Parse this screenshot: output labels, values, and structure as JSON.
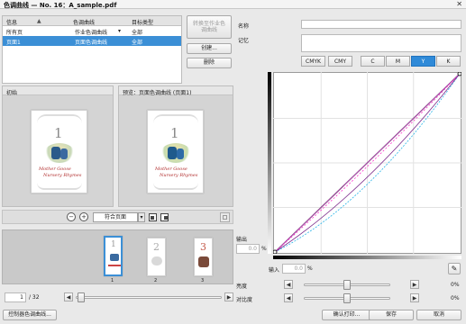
{
  "window": {
    "title": "色调曲线 — No. 16：A_sample.pdf",
    "close_glyph": "✕"
  },
  "table": {
    "columns": [
      "信息",
      "色调曲线",
      "目标类型"
    ],
    "sort_glyph": "▲",
    "rows": [
      {
        "info": "所有页",
        "curve": "作业色调曲线",
        "curve_glyph": "▾",
        "target": "全部",
        "selected": false
      },
      {
        "info": "页面1",
        "curve": "页面色调曲线",
        "curve_glyph": "",
        "target": "全部",
        "selected": true
      }
    ]
  },
  "buttons": {
    "convert": "转换至作业色\n调曲线",
    "create": "创建...",
    "delete": "删除",
    "control_tone": "控制器色调曲线...",
    "confirm_print": "确认打印...",
    "save": "保存",
    "cancel": "取消"
  },
  "panes": {
    "initial_label": "初始",
    "preview_label": "预览：页面色调曲线 (页面1)",
    "doc_number": "1",
    "doc_title_line1": "Mother Goose",
    "doc_title_line2": "Nursery Rhymes"
  },
  "zoom": {
    "zoom_out_glyph": "−",
    "zoom_in_glyph": "+",
    "fit_value": "符合页面",
    "fit_glyph": "▾"
  },
  "thumbnails": [
    {
      "label": "1",
      "number": "1",
      "color": "#cfcfcf"
    },
    {
      "label": "2",
      "number": "2",
      "color": "#c8c8c8"
    },
    {
      "label": "3",
      "number": "3",
      "color": "#c45a4a"
    }
  ],
  "pager": {
    "current": "1",
    "total": "/ 32",
    "prev_glyph": "◀",
    "next_glyph": "▶"
  },
  "right": {
    "name_label": "名称",
    "memo_label": "记忆",
    "channels": [
      "CMYK",
      "CMY",
      "C",
      "M",
      "Y",
      "K"
    ],
    "active_channel": "Y",
    "output_label": "输出",
    "output_value": "0.0",
    "input_label": "输入",
    "input_value": "0.0",
    "percent": "%",
    "brightness_label": "亮度",
    "brightness_value": "0%",
    "contrast_label": "对比度",
    "contrast_value": "0%",
    "left_glyph": "◀",
    "right_glyph": "▶",
    "pen_icon_glyph": "✎"
  },
  "curve_data": {
    "type": "line",
    "series": [
      {
        "color": "#222222",
        "points": [
          [
            0,
            0
          ],
          [
            100,
            100
          ]
        ]
      },
      {
        "color": "#d050d0",
        "points": [
          [
            0,
            0
          ],
          [
            100,
            100
          ]
        ]
      },
      {
        "color": "#ff33cc",
        "points": [
          [
            0,
            0
          ],
          [
            50,
            48
          ],
          [
            100,
            100
          ]
        ]
      },
      {
        "color": "#2bb5e8",
        "points": [
          [
            0,
            0
          ],
          [
            50,
            38
          ],
          [
            100,
            100
          ]
        ]
      },
      {
        "color": "#7a2a8a",
        "points": [
          [
            0,
            0
          ],
          [
            50,
            42
          ],
          [
            100,
            100
          ]
        ]
      }
    ],
    "xlim": [
      0,
      100
    ],
    "ylim": [
      0,
      100
    ]
  }
}
